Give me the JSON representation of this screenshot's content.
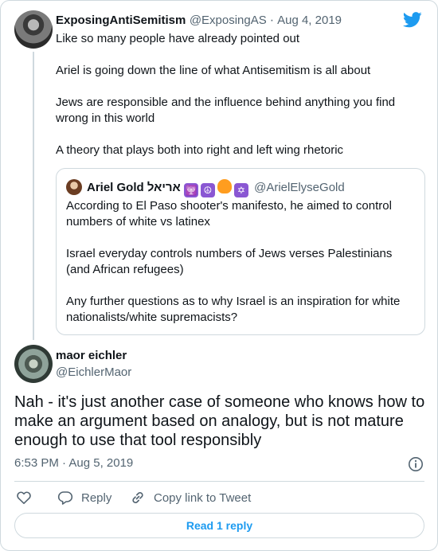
{
  "parent": {
    "name": "ExposingAntiSemitism",
    "handle": "@ExposingAS",
    "date": "Aug 4, 2019",
    "paragraphs": [
      "Like so many people have already pointed out",
      "Ariel is going down the line of what Antisemitism is all about",
      "Jews are responsible and the influence behind anything you find wrong in this world",
      "A theory that plays both into right and left wing rhetoric"
    ]
  },
  "quote": {
    "name": "Ariel Gold אריאל",
    "handle": "@ArielElyseGold",
    "emojis": [
      "menorah",
      "peace-symbol",
      "fire",
      "star-of-david"
    ],
    "paragraphs": [
      "According to El Paso shooter's manifesto, he aimed to control numbers of white vs latinex",
      "Israel everyday controls numbers of Jews verses Palestinians (and African refugees)",
      "Any further questions as to why Israel is an inspiration for white nationalists/white supremacists?"
    ]
  },
  "main": {
    "name": "maor eichler",
    "handle": "@EichlerMaor",
    "text": "Nah - it's just another case of someone who knows how to make an argument based on analogy, but is not mature enough to use that tool responsibly",
    "timestamp": "6:53 PM · Aug 5, 2019"
  },
  "actions": {
    "reply_label": "Reply",
    "copy_label": "Copy link to Tweet",
    "read_replies_label": "Read 1 reply"
  },
  "colors": {
    "accent": "#1d9bf0",
    "muted": "#536471",
    "border": "#cfd9de"
  }
}
